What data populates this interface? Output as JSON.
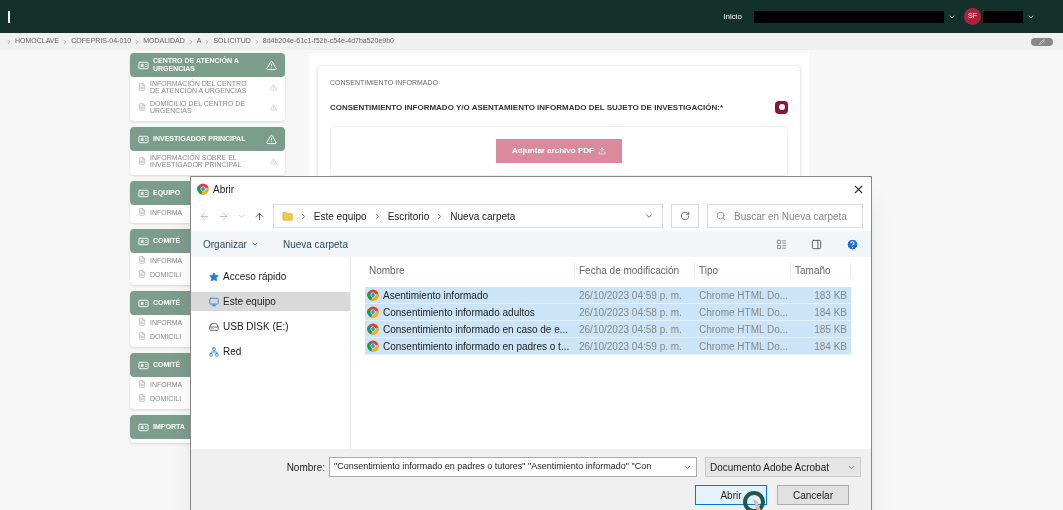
{
  "header": {
    "nav_link": "Inicio",
    "avatar": "SF"
  },
  "breadcrumb": [
    "HOMOCLAVE",
    "COFEPRIS-04-010",
    "MODALIDAD",
    "A",
    "SOLICITUD",
    "8d4b204e-61c1-f52b-c54e-4d7ba520e9b0"
  ],
  "sidebar": [
    {
      "title": "CENTRO DE ATENCIÓN A URGENCIAS",
      "warning": true,
      "items": [
        "INFORMACIÓN DEL CENTRO DE ATENCIÓN A URGENCIAS",
        "DOMICILIO DEL CENTRO DE URGENCIAS"
      ]
    },
    {
      "title": "INVESTIGADOR PRINCIPAL",
      "warning": true,
      "items": [
        "INFORMACIÓN SOBRE EL INVESTIGADOR PRINCIPAL"
      ]
    },
    {
      "title": "EQUIPO",
      "items": [
        "INFORMA"
      ]
    },
    {
      "title": "COMITÉ",
      "items": [
        "INFORMA",
        "DOMICILI"
      ]
    },
    {
      "title": "COMITÉ",
      "items": [
        "INFORMA",
        "DOMICILI"
      ]
    },
    {
      "title": "COMITÉ",
      "items": [
        "INFORMA",
        "DOMICILI"
      ]
    },
    {
      "title": "IMPORTA"
    }
  ],
  "card": {
    "section_label": "CONSENTIMIENTO INFORMADO",
    "question": "CONSENTIMIENTO INFORMADO Y/O ASENTAMIENTO INFORMADO DEL SUJETO DE INVESTIGACIÓN:*",
    "upload_button": "Adjuntar archivo PDF"
  },
  "dialog": {
    "title": "Abrir",
    "path": [
      "Este equipo",
      "Escritorio",
      "Nueva carpeta"
    ],
    "search": {
      "placeholder": "Buscar en Nueva carpeta"
    },
    "toolbar": {
      "organize": "Organizar",
      "new_folder": "Nueva carpeta"
    },
    "nav_pane": [
      {
        "label": "Acceso rápido",
        "kind": "star",
        "selected": false
      },
      {
        "label": "Este equipo",
        "kind": "computer",
        "selected": true
      },
      {
        "label": "USB DISK (E:)",
        "kind": "drive",
        "selected": false
      },
      {
        "label": "Red",
        "kind": "network",
        "selected": false
      }
    ],
    "columns": [
      "Nombre",
      "Fecha de modificación",
      "Tipo",
      "Tamaño"
    ],
    "files": [
      {
        "name": "Asentimiento informado",
        "date": "26/10/2023 04:59 p. m.",
        "type": "Chrome HTML Do...",
        "size": "183 KB",
        "selected": true
      },
      {
        "name": "Consentimiento informado adultos",
        "date": "26/10/2023 04:58 p. m.",
        "type": "Chrome HTML Do...",
        "size": "184 KB",
        "selected": true
      },
      {
        "name": "Consentimiento informado en caso de e...",
        "date": "26/10/2023 04:58 p. m.",
        "type": "Chrome HTML Do...",
        "size": "185 KB",
        "selected": true
      },
      {
        "name": "Consentimiento informado en padres o t...",
        "date": "26/10/2023 04:59 p. m.",
        "type": "Chrome HTML Do...",
        "size": "184 KB",
        "selected": true
      }
    ],
    "filename_label": "Nombre:",
    "filename": "\"Consentimiento informado en padres o tutores\" \"Asentimiento informado\" \"Con",
    "filetype": "Documento Adobe Acrobat",
    "open_button": "Abrir",
    "cancel_button": "Cancelar"
  }
}
